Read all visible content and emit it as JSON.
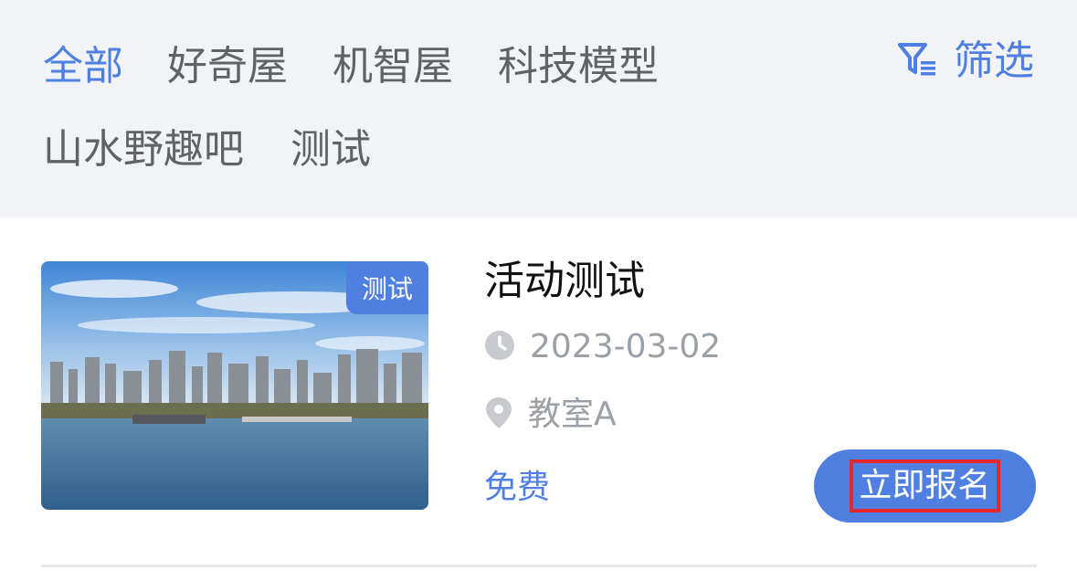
{
  "categories": [
    {
      "label": "全部",
      "active": true
    },
    {
      "label": "好奇屋"
    },
    {
      "label": "机智屋"
    },
    {
      "label": "科技模型"
    },
    {
      "label": "山水野趣吧"
    },
    {
      "label": "测试"
    }
  ],
  "filter": {
    "label": "筛选",
    "icon": "filter-icon"
  },
  "activity": {
    "tag": "测试",
    "title": "活动测试",
    "date": "2023-03-02",
    "location": "教室A",
    "price": "免费",
    "signup_label": "立即报名",
    "icons": {
      "date": "clock-icon",
      "location": "location-pin-icon"
    }
  },
  "colors": {
    "accent": "#4f7fe0",
    "text_primary": "#111111",
    "text_secondary": "#5f6368",
    "text_muted": "#9aa0a6",
    "highlight_border": "#e8262d",
    "background": "#f2f3f7"
  }
}
